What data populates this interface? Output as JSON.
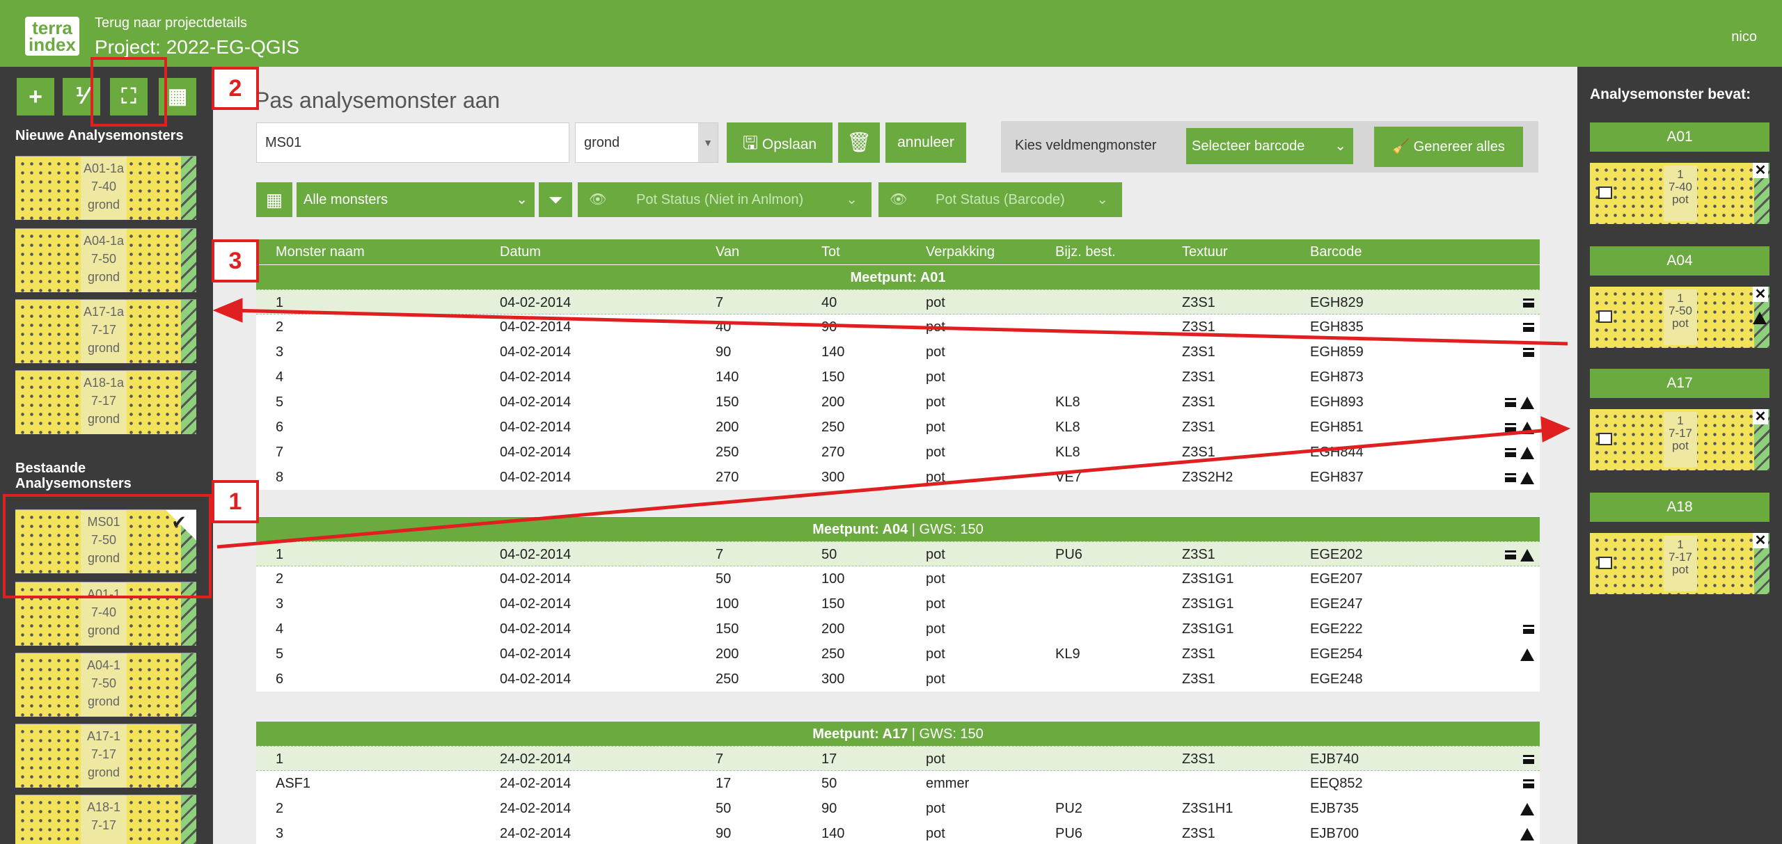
{
  "header": {
    "logo_line1": "terra",
    "logo_line2": "index",
    "back_link": "Terug naar projectdetails",
    "project_title": "Project: 2022-EG-QGIS",
    "user": "nico"
  },
  "sidebar": {
    "tools": [
      "+",
      "⅟",
      "⛶",
      "▦"
    ],
    "new_heading": "Nieuwe Analysemonsters",
    "existing_heading_line1": "Bestaande",
    "existing_heading_line2": "Analysemonsters",
    "new_samples": [
      {
        "name": "A01-1a",
        "range": "7-40",
        "type": "grond"
      },
      {
        "name": "A04-1a",
        "range": "7-50",
        "type": "grond"
      },
      {
        "name": "A17-1a",
        "range": "7-17",
        "type": "grond"
      },
      {
        "name": "A18-1a",
        "range": "7-17",
        "type": "grond"
      }
    ],
    "existing_samples": [
      {
        "name": "MS01",
        "range": "7-50",
        "type": "grond"
      },
      {
        "name": "A01-1",
        "range": "7-40",
        "type": "grond"
      },
      {
        "name": "A04-1",
        "range": "7-50",
        "type": "grond"
      },
      {
        "name": "A17-1",
        "range": "7-17",
        "type": "grond"
      },
      {
        "name": "A18-1",
        "range": "7-17",
        "type": ""
      }
    ]
  },
  "main": {
    "page_title": "Pas analysemonster aan",
    "name_value": "MS01",
    "type_value": "grond",
    "save_label": "Opslaan",
    "cancel_label": "annuleer",
    "barcode_panel_label": "Kies veldmengmonster",
    "barcode_select": "Selecteer barcode",
    "generate_label": "Genereer alles",
    "filter_all": "Alle monsters",
    "pot_status_anlmon": "Pot Status (Niet in Anlmon)",
    "pot_status_barcode": "Pot Status (Barcode)"
  },
  "table": {
    "headers": [
      "Monster naam",
      "Datum",
      "Van",
      "Tot",
      "Verpakking",
      "Bijz. best.",
      "Textuur",
      "Barcode"
    ],
    "groups": [
      {
        "title": "Meetpunt: A01",
        "gws": "",
        "rows": [
          {
            "naam": "1",
            "datum": "04-02-2014",
            "van": "7",
            "tot": "40",
            "verpakking": "pot",
            "bijz": "",
            "textuur": "Z3S1",
            "barcode": "EGH829",
            "box": true,
            "warn": false,
            "hl": true
          },
          {
            "naam": "2",
            "datum": "04-02-2014",
            "van": "40",
            "tot": "90",
            "verpakking": "pot",
            "bijz": "",
            "textuur": "Z3S1",
            "barcode": "EGH835",
            "box": true,
            "warn": false
          },
          {
            "naam": "3",
            "datum": "04-02-2014",
            "van": "90",
            "tot": "140",
            "verpakking": "pot",
            "bijz": "",
            "textuur": "Z3S1",
            "barcode": "EGH859",
            "box": true,
            "warn": false
          },
          {
            "naam": "4",
            "datum": "04-02-2014",
            "van": "140",
            "tot": "150",
            "verpakking": "pot",
            "bijz": "",
            "textuur": "Z3S1",
            "barcode": "EGH873",
            "box": false,
            "warn": false
          },
          {
            "naam": "5",
            "datum": "04-02-2014",
            "van": "150",
            "tot": "200",
            "verpakking": "pot",
            "bijz": "KL8",
            "textuur": "Z3S1",
            "barcode": "EGH893",
            "box": true,
            "warn": true
          },
          {
            "naam": "6",
            "datum": "04-02-2014",
            "van": "200",
            "tot": "250",
            "verpakking": "pot",
            "bijz": "KL8",
            "textuur": "Z3S1",
            "barcode": "EGH851",
            "box": true,
            "warn": true
          },
          {
            "naam": "7",
            "datum": "04-02-2014",
            "van": "250",
            "tot": "270",
            "verpakking": "pot",
            "bijz": "KL8",
            "textuur": "Z3S1",
            "barcode": "EGH844",
            "box": true,
            "warn": true
          },
          {
            "naam": "8",
            "datum": "04-02-2014",
            "van": "270",
            "tot": "300",
            "verpakking": "pot",
            "bijz": "VE7",
            "textuur": "Z3S2H2",
            "barcode": "EGH837",
            "box": true,
            "warn": true
          }
        ]
      },
      {
        "title": "Meetpunt: A04",
        "gws": " | GWS: 150",
        "rows": [
          {
            "naam": "1",
            "datum": "04-02-2014",
            "van": "7",
            "tot": "50",
            "verpakking": "pot",
            "bijz": "PU6",
            "textuur": "Z3S1",
            "barcode": "EGE202",
            "box": true,
            "warn": true,
            "hl": true
          },
          {
            "naam": "2",
            "datum": "04-02-2014",
            "van": "50",
            "tot": "100",
            "verpakking": "pot",
            "bijz": "",
            "textuur": "Z3S1G1",
            "barcode": "EGE207",
            "box": false,
            "warn": false
          },
          {
            "naam": "3",
            "datum": "04-02-2014",
            "van": "100",
            "tot": "150",
            "verpakking": "pot",
            "bijz": "",
            "textuur": "Z3S1G1",
            "barcode": "EGE247",
            "box": false,
            "warn": false
          },
          {
            "naam": "4",
            "datum": "04-02-2014",
            "van": "150",
            "tot": "200",
            "verpakking": "pot",
            "bijz": "",
            "textuur": "Z3S1G1",
            "barcode": "EGE222",
            "box": true,
            "warn": false
          },
          {
            "naam": "5",
            "datum": "04-02-2014",
            "van": "200",
            "tot": "250",
            "verpakking": "pot",
            "bijz": "KL9",
            "textuur": "Z3S1",
            "barcode": "EGE254",
            "box": false,
            "warn": true
          },
          {
            "naam": "6",
            "datum": "04-02-2014",
            "van": "250",
            "tot": "300",
            "verpakking": "pot",
            "bijz": "",
            "textuur": "Z3S1",
            "barcode": "EGE248",
            "box": false,
            "warn": false
          }
        ]
      },
      {
        "title": "Meetpunt: A17",
        "gws": " | GWS: 150",
        "rows": [
          {
            "naam": "1",
            "datum": "24-02-2014",
            "van": "7",
            "tot": "17",
            "verpakking": "pot",
            "bijz": "",
            "textuur": "Z3S1",
            "barcode": "EJB740",
            "box": true,
            "warn": false,
            "hl": true
          },
          {
            "naam": "ASF1",
            "datum": "24-02-2014",
            "van": "17",
            "tot": "50",
            "verpakking": "emmer",
            "bijz": "",
            "textuur": "",
            "barcode": "EEQ852",
            "box": true,
            "warn": false
          },
          {
            "naam": "2",
            "datum": "24-02-2014",
            "van": "50",
            "tot": "90",
            "verpakking": "pot",
            "bijz": "PU2",
            "textuur": "Z3S1H1",
            "barcode": "EJB735",
            "box": false,
            "warn": true
          },
          {
            "naam": "3",
            "datum": "24-02-2014",
            "van": "90",
            "tot": "140",
            "verpakking": "pot",
            "bijz": "PU6",
            "textuur": "Z3S1",
            "barcode": "EJB700",
            "box": false,
            "warn": true
          }
        ]
      }
    ]
  },
  "right_panel": {
    "title": "Analysemonster bevat:",
    "groups": [
      {
        "label": "A01",
        "num": "1",
        "range": "7-40",
        "type": "pot",
        "warn": false
      },
      {
        "label": "A04",
        "num": "1",
        "range": "7-50",
        "type": "pot",
        "warn": true
      },
      {
        "label": "A17",
        "num": "1",
        "range": "7-17",
        "type": "pot",
        "warn": false
      },
      {
        "label": "A18",
        "num": "1",
        "range": "7-17",
        "type": "pot",
        "warn": false
      }
    ]
  },
  "annotations": {
    "marker_1": "1",
    "marker_2": "2",
    "marker_3": "3",
    "annotation_color": "#e02020"
  },
  "colors": {
    "brand_green": "#6aaa3f",
    "sidebar_dark": "#3b3b3b",
    "plate_yellow": "#f2e35a"
  }
}
